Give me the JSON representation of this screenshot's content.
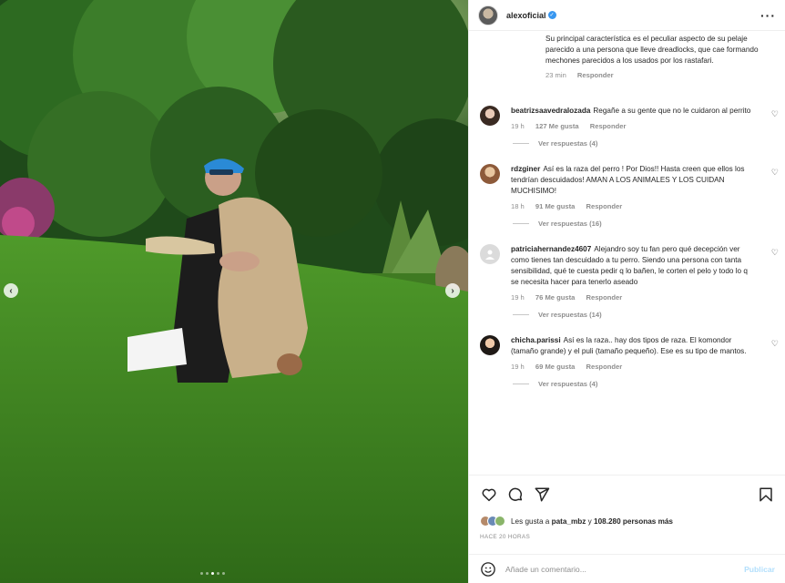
{
  "post": {
    "username": "alexoficial",
    "more_icon": "more-horizontal-icon"
  },
  "caption": {
    "continuation": "Su principal característica es el peculiar aspecto de su pelaje parecido a una persona que lleve dreadlocks, que cae formando mechones parecidos a los usados por los rastafari.",
    "time": "23 min",
    "reply": "Responder"
  },
  "comments": [
    {
      "user": "beatrizsaavedralozada",
      "text": "Regañe a su gente que no le cuidaron al perrito",
      "time": "19 h",
      "likes": "127 Me gusta",
      "reply": "Responder",
      "replies": "Ver respuestas (4)"
    },
    {
      "user": "rdzginer",
      "text": "Así es la raza del perro ! Por Dios!! Hasta creen que ellos los tendrían descuidados! AMAN A LOS ANIMALES Y LOS CUIDAN MUCHISIMO!",
      "time": "18 h",
      "likes": "91 Me gusta",
      "reply": "Responder",
      "replies": "Ver respuestas (16)"
    },
    {
      "user": "patriciahernandez4607",
      "text": "Alejandro soy tu fan pero qué decepción ver como tienes tan descuidado a tu perro. Siendo una persona con tanta sensibilidad, qué te cuesta pedir q lo bañen, le corten el pelo y todo lo q se necesita hacer para tenerlo aseado",
      "time": "19 h",
      "likes": "76 Me gusta",
      "reply": "Responder",
      "replies": "Ver respuestas (14)"
    },
    {
      "user": "chicha.parissi",
      "text": "Así es la raza.. hay dos tipos de raza. El komondor (tamaño grande) y el puli (tamaño pequeño). Ese es su tipo de mantos.",
      "time": "19 h",
      "likes": "69 Me gusta",
      "reply": "Responder",
      "replies": "Ver respuestas (4)"
    }
  ],
  "actions": {
    "like_icon": "heart-icon",
    "comment_icon": "comment-icon",
    "share_icon": "share-icon",
    "save_icon": "bookmark-icon"
  },
  "likes": {
    "prefix": "Les gusta a",
    "user": "pata_mbz",
    "middle": "y",
    "count": "108.280 personas más"
  },
  "time_ago": "HACE 20 HORAS",
  "add_comment": {
    "placeholder": "Añade un comentario...",
    "publish": "Publicar"
  },
  "colors": {
    "verified": "#3897f0",
    "publish_disabled": "#b2dffc",
    "secondary_text": "#8e8e8e"
  }
}
